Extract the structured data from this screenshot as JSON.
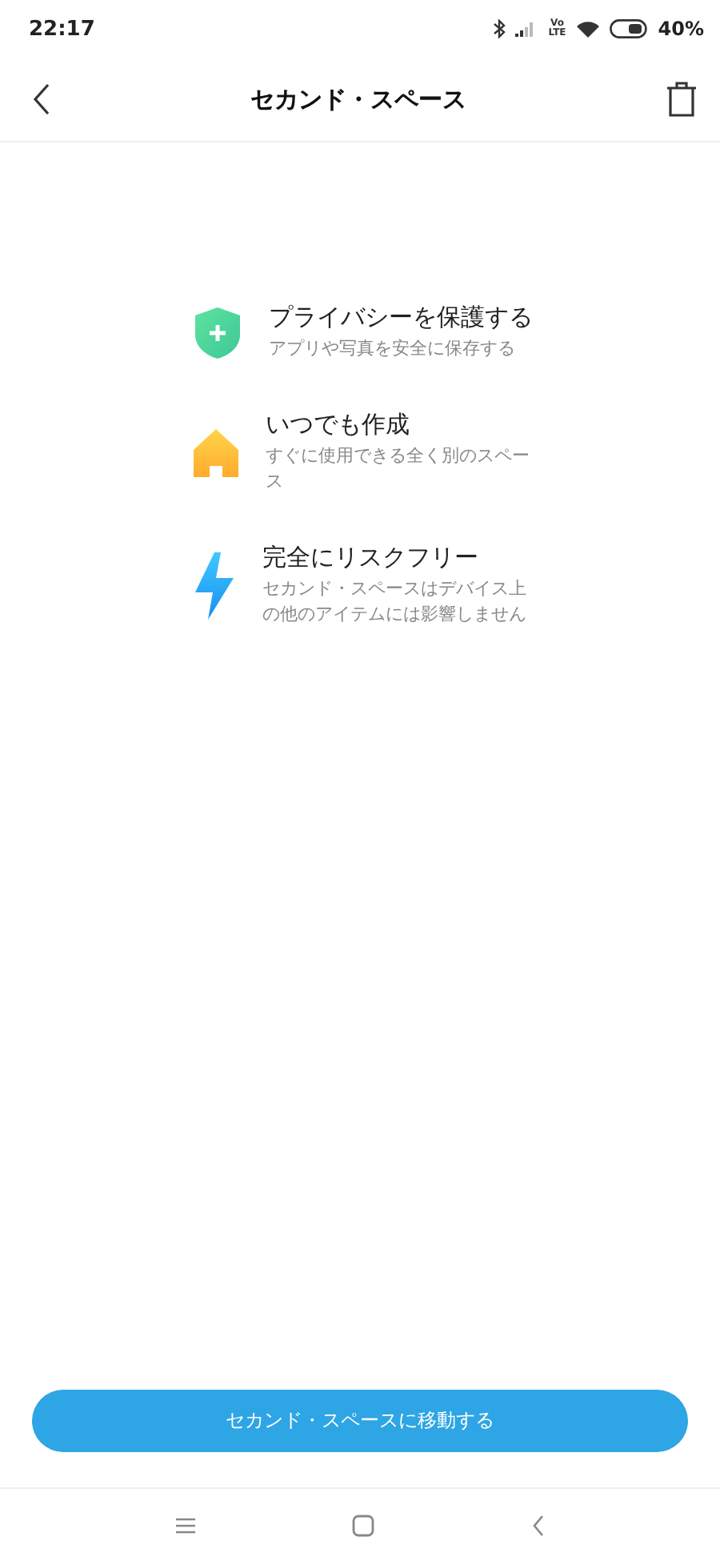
{
  "status_bar": {
    "time": "22:17",
    "network": "Vo LTE",
    "battery": "40%"
  },
  "header": {
    "title": "セカンド・スペース"
  },
  "features": [
    {
      "kind": "shield",
      "title": "プライバシーを保護する",
      "description": "アプリや写真を安全に保存する"
    },
    {
      "kind": "house",
      "title": "いつでも作成",
      "description": "すぐに使用できる全く別のスペース"
    },
    {
      "kind": "bolt",
      "title": "完全にリスクフリー",
      "description": "セカンド・スペースはデバイス上の他のアイテムには影響しません"
    }
  ],
  "action_button": {
    "label": "セカンド・スペースに移動する"
  }
}
